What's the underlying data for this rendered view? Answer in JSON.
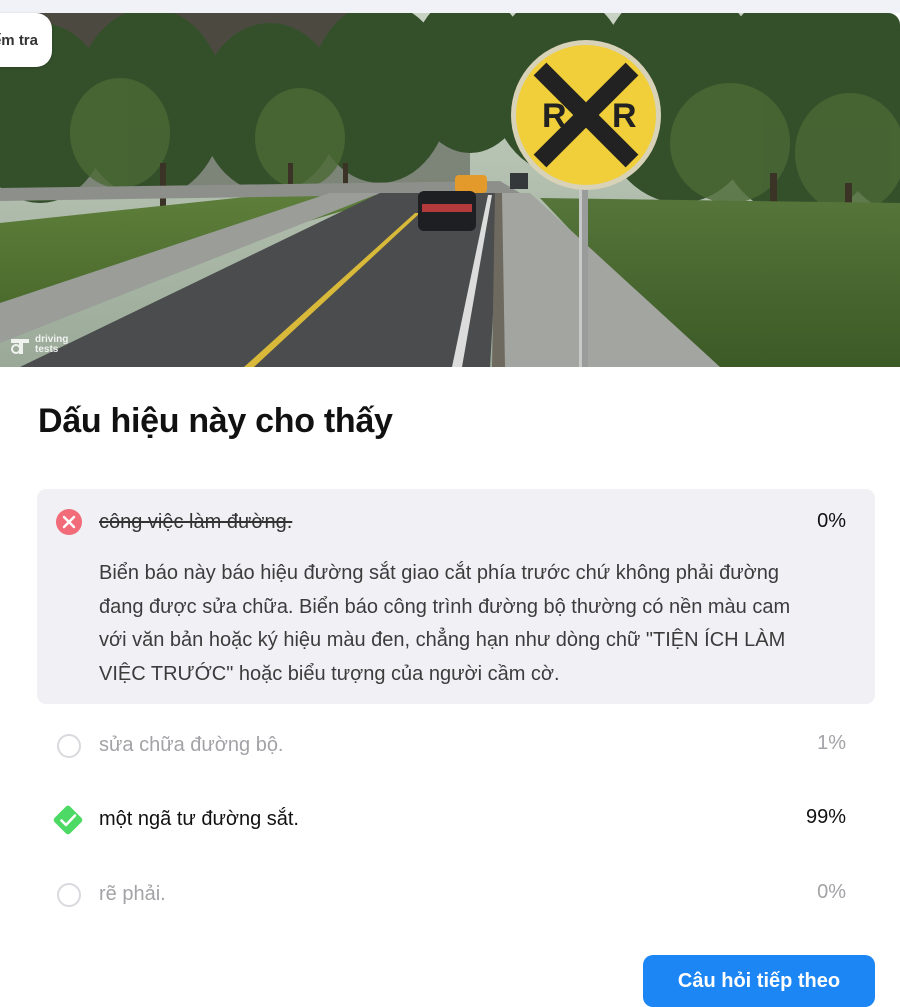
{
  "top_pill": {
    "label": "Kiểm tra"
  },
  "hero": {
    "sign_letter_left": "R",
    "sign_letter_right": "R",
    "watermark_line1": "driving",
    "watermark_line2": "tests",
    "sign_icon": "railroad-crossing-sign",
    "watermark_icon": "driving-tests-logo-icon"
  },
  "question": {
    "title": "Dấu hiệu này cho thấy"
  },
  "answers": [
    {
      "text": "công việc làm đường.",
      "percent": "0%",
      "state": "selected-wrong",
      "icon": "x-circle-icon",
      "explanation": "Biển báo này báo hiệu đường sắt giao cắt phía trước chứ không phải đường đang được sửa chữa. Biển báo công trình đường bộ thường có nền màu cam với văn bản hoặc ký hiệu màu đen, chẳng hạn như dòng chữ \"TIỆN ÍCH LÀM VIỆC TRƯỚC\" hoặc biểu tượng của người cầm cờ."
    },
    {
      "text": "sửa chữa đường bộ.",
      "percent": "1%",
      "state": "unselected",
      "icon": "radio-icon"
    },
    {
      "text": "một ngã tư đường sắt.",
      "percent": "99%",
      "state": "correct",
      "icon": "check-diamond-icon"
    },
    {
      "text": "rẽ phải.",
      "percent": "0%",
      "state": "unselected",
      "icon": "radio-icon"
    }
  ],
  "next_button": {
    "label": "Câu hỏi tiếp theo"
  },
  "colors": {
    "wrong": "#f16b78",
    "correct": "#4cd964",
    "button": "#1c86f5",
    "explanation_bg": "#f1f1f5",
    "sign_yellow": "#f0cf3a"
  }
}
